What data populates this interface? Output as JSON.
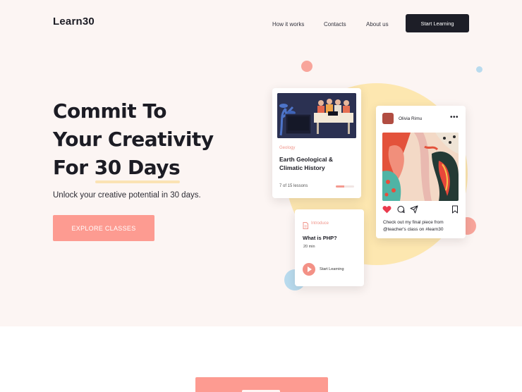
{
  "brand": {
    "logo": "Learn30"
  },
  "nav": {
    "links": [
      "How it works",
      "Contacts",
      "About us"
    ],
    "cta": "Start Learning"
  },
  "hero": {
    "title_lines": [
      "Commit To",
      "Your Creativity",
      "For 30 Days"
    ],
    "subtitle": "Unlock your creative potential in 30 days.",
    "button": "EXPLORE CLASSES"
  },
  "course_card": {
    "category": "Geology",
    "title": "Earth Geological & Climatic History",
    "progress_text": "7 of 15 lessons",
    "progress_fraction": 0.47
  },
  "social_card": {
    "username": "Olivia Rimu",
    "more_icon": "more-dots-icon",
    "icons": [
      "heart-icon",
      "comment-icon",
      "share-icon",
      "bookmark-icon"
    ],
    "caption": "Check out my final piece from @teacher's class on #learn30"
  },
  "lesson_card": {
    "category": "Introduce",
    "title": "What is PHP?",
    "duration": "20 min",
    "action": "Start Learning"
  },
  "colors": {
    "accent": "#fd9b91",
    "dark": "#1d1e27",
    "hero_bg": "#fcf5f3",
    "yellow": "#fde7b0",
    "blue": "#b9dbee"
  }
}
